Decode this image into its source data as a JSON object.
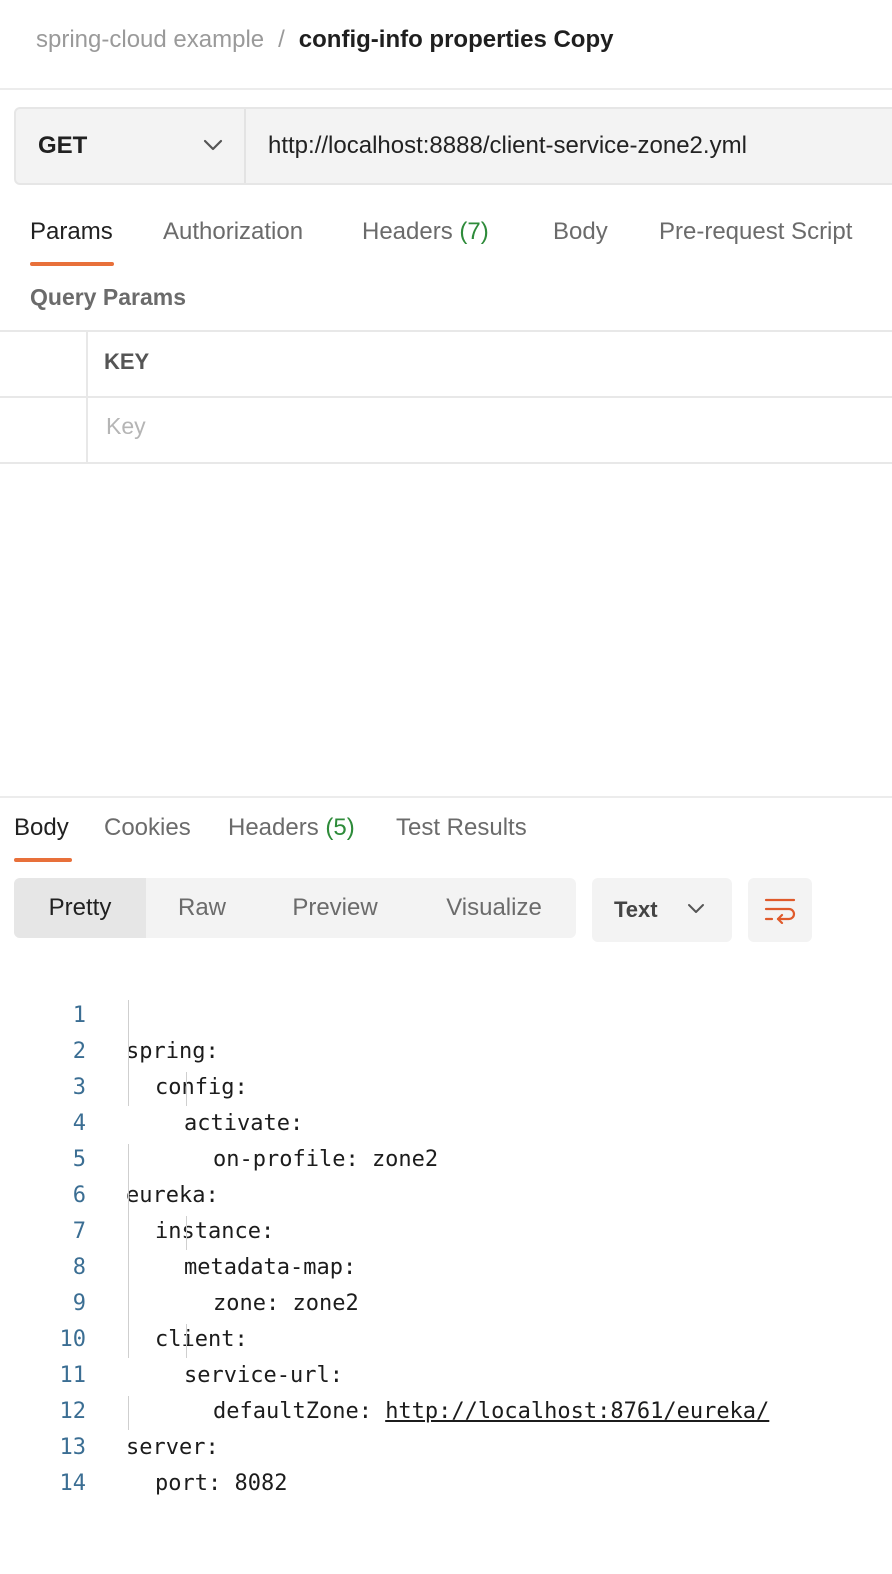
{
  "breadcrumb": {
    "parent": "spring-cloud example",
    "separator": "/",
    "current": "config-info properties Copy"
  },
  "request": {
    "method": "GET",
    "url": "http://localhost:8888/client-service-zone2.yml"
  },
  "request_tabs": {
    "params": "Params",
    "authorization": "Authorization",
    "headers": "Headers",
    "headers_count": "(7)",
    "body": "Body",
    "pre_request": "Pre-request Script"
  },
  "query_params": {
    "title": "Query Params",
    "key_header": "KEY",
    "key_placeholder": "Key"
  },
  "response_tabs": {
    "body": "Body",
    "cookies": "Cookies",
    "headers": "Headers",
    "headers_count": "(5)",
    "test_results": "Test Results"
  },
  "view_modes": {
    "pretty": "Pretty",
    "raw": "Raw",
    "preview": "Preview",
    "visualize": "Visualize"
  },
  "format_select": "Text",
  "icons": {
    "method_dropdown": "chevron-down-icon",
    "format_dropdown": "chevron-down-icon",
    "wrap": "wrap-lines-icon"
  },
  "colors": {
    "accent": "#e8703a",
    "count_green": "#2e8b3a",
    "line_number": "#3b6e93"
  },
  "code": {
    "lines": [
      {
        "n": "1",
        "text": "spring:"
      },
      {
        "n": "2",
        "text": "config:"
      },
      {
        "n": "3",
        "text": "activate:"
      },
      {
        "n": "4",
        "text": "on-profile: zone2"
      },
      {
        "n": "5",
        "text": "eureka:"
      },
      {
        "n": "6",
        "text": "instance:"
      },
      {
        "n": "7",
        "text": "metadata-map:"
      },
      {
        "n": "8",
        "text": "zone: zone2"
      },
      {
        "n": "9",
        "text": "client:"
      },
      {
        "n": "10",
        "text": "service-url:"
      },
      {
        "n": "11",
        "text": "defaultZone: ",
        "link": "http://localhost:8761/eureka/"
      },
      {
        "n": "12",
        "text": "server:"
      },
      {
        "n": "13",
        "text": "port: 8082"
      },
      {
        "n": "14",
        "text": ""
      }
    ]
  }
}
